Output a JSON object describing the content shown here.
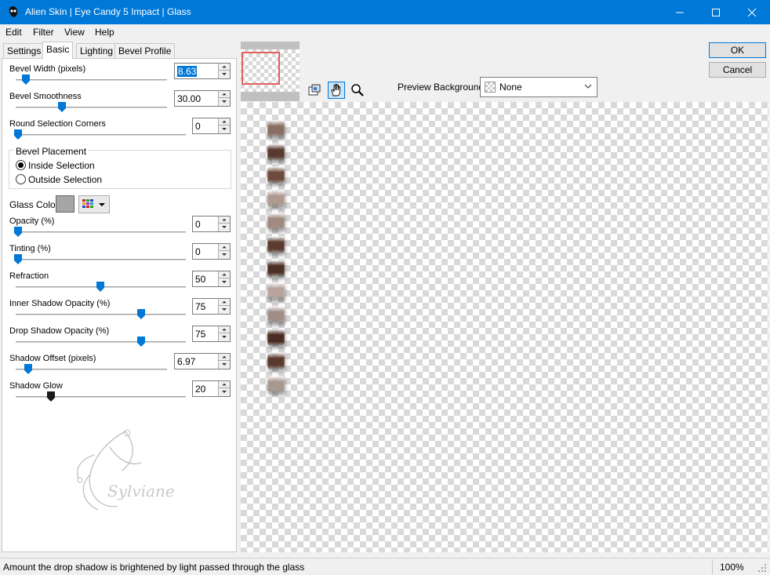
{
  "window": {
    "title": "Alien Skin | Eye Candy 5 Impact | Glass",
    "minimize_icon": "minimize-icon",
    "maximize_icon": "maximize-icon",
    "close_icon": "close-icon"
  },
  "menu": {
    "items": [
      {
        "label": "Edit",
        "accel": "E"
      },
      {
        "label": "Filter",
        "accel": "F"
      },
      {
        "label": "View",
        "accel": "V"
      },
      {
        "label": "Help",
        "accel": "H"
      }
    ]
  },
  "tabs": [
    "Settings",
    "Basic",
    "Lighting",
    "Bevel Profile"
  ],
  "active_tab": "Basic",
  "controls": {
    "bevel_width": {
      "label": "Bevel Width (pixels)",
      "value": "8.63",
      "slider_fraction": 0.06
    },
    "bevel_smoothness": {
      "label": "Bevel Smoothness",
      "value": "30.00",
      "slider_fraction": 0.3
    },
    "round_corners": {
      "label": "Round Selection Corners",
      "value": "0",
      "slider_fraction": 0.0
    },
    "bevel_placement": {
      "title": "Bevel Placement",
      "options": [
        "Inside Selection",
        "Outside Selection"
      ],
      "selected": "Inside Selection"
    },
    "glass_color": {
      "label": "Glass Color",
      "color": "#a6a6a6"
    },
    "opacity": {
      "label": "Opacity (%)",
      "value": "0",
      "slider_fraction": 0.0
    },
    "tinting": {
      "label": "Tinting (%)",
      "value": "0",
      "slider_fraction": 0.0
    },
    "refraction": {
      "label": "Refraction",
      "value": "50",
      "slider_fraction": 0.5
    },
    "inner_shadow": {
      "label": "Inner Shadow Opacity (%)",
      "value": "75",
      "slider_fraction": 0.75
    },
    "drop_shadow": {
      "label": "Drop Shadow Opacity (%)",
      "value": "75",
      "slider_fraction": 0.75
    },
    "shadow_offset": {
      "label": "Shadow Offset (pixels)",
      "value": "6.97",
      "slider_fraction": 0.09
    },
    "shadow_glow": {
      "label": "Shadow Glow",
      "value": "20",
      "slider_fraction": 0.2
    }
  },
  "buttons": {
    "ok": "OK",
    "cancel": "Cancel"
  },
  "preview_background": {
    "label": "Preview Background:",
    "value": "None"
  },
  "tools": [
    "zoom-fit-icon",
    "hand-icon",
    "magnifier-icon"
  ],
  "watermark_text": "Sylviane",
  "beads": [
    {
      "color": "#8a6e62"
    },
    {
      "color": "#5a3a2e"
    },
    {
      "color": "#6e4a3c"
    },
    {
      "color": "#b09a90"
    },
    {
      "color": "#a08a80"
    },
    {
      "color": "#5c3a2e"
    },
    {
      "color": "#4e3026"
    },
    {
      "color": "#b8a49c"
    },
    {
      "color": "#a08e86"
    },
    {
      "color": "#4a2c22"
    },
    {
      "color": "#5a3a2e"
    },
    {
      "color": "#a89890"
    }
  ],
  "status": {
    "message": "Amount the drop shadow is brightened by light passed through the glass",
    "zoom": "100%"
  },
  "colors": {
    "accent": "#0078d7",
    "slider_thumb": "#0078d7",
    "glow_thumb": "#1a1a1a"
  }
}
